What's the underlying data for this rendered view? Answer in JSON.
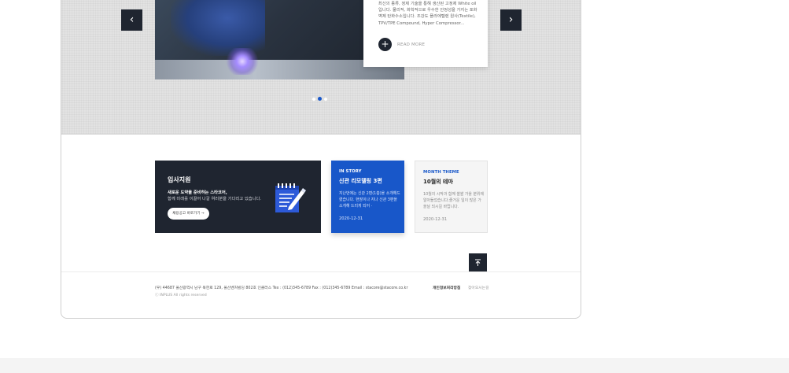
{
  "slider": {
    "card_text": "최신의 종류, 정제 기술을 통해 생산된 고정제 White oil 입니다. 물리적, 화학적으로 우수한 안정성을 가지는 포화벽제 탄화수소입니다. 조강도 플라에텔렌 원사(Textile), TPV/TPE Compound, Hyper Compressor...",
    "read_more": "READ MORE",
    "prev_icon": "chevron-left-icon",
    "next_icon": "chevron-right-icon",
    "dots_total": 3,
    "dots_active": 2
  },
  "recruit": {
    "title": "입사지원",
    "line1": "새로운 도약을 준비하는 스타코어,",
    "line2": "함께 미래를 이끌어 나갈 여러분을 기다리고 있습니다.",
    "button": "채용공고 바로가기 →",
    "icon": "notepad-icon"
  },
  "story": {
    "tag": "IN STORY",
    "title": "신관 리모델링 3편",
    "desc": "지난번에는 신관 2편(1층)을 소개해드렸습니다. 현장이나 지나 신관 3편을 소개해 드리게 되어 ·",
    "date": "2020-12-31"
  },
  "theme": {
    "tag": "MONTH THEME",
    "title": "10월의 테마",
    "desc": "10월의 시작과 함께 쌀쌀 가을 분위에 알아들었습니다.즐거운 일이 많은 가을날 되시길 바랍니다.",
    "date": "2020-12-31"
  },
  "colors": {
    "accent": "#1857c9",
    "dark": "#1f2530"
  },
  "footer": {
    "address": "(우) 44687  울산광역시 남구 북한로 129, 울산벤처빌딩 802호 인클러스     Tex : (012)345-6789     Fax : (012)345-6789     Email : stacore@stacore.co.kr",
    "copyright": "ⓒ INPLUS All rights reserved",
    "privacy": "개인정보처리방침",
    "terms": "찾아오시는길"
  },
  "top_button_icon": "arrow-to-top-icon"
}
